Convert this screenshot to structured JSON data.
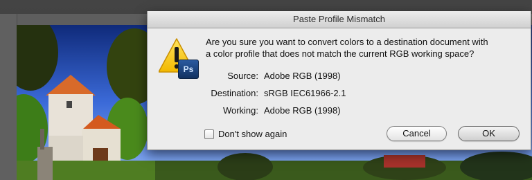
{
  "dialog": {
    "title": "Paste Profile Mismatch",
    "message": "Are you sure you want to convert colors to a destination document with\na color profile that does not match the current RGB working space?",
    "icon": "warning-triangle-icon",
    "badge_icon": "photoshop-ps-icon",
    "badge_text": "Ps",
    "source_label": "Source:",
    "source_value": "Adobe RGB (1998)",
    "destination_label": "Destination:",
    "destination_value": "sRGB IEC61966-2.1",
    "working_label": "Working:",
    "working_value": "Adobe RGB (1998)",
    "checkbox_label": "Don't show again",
    "checkbox_checked": false,
    "cancel_label": "Cancel",
    "ok_label": "OK"
  },
  "colors": {
    "dialog_bg": "#ececec",
    "warning_yellow": "#f5c400",
    "ps_blue": "#1b3f7a"
  }
}
